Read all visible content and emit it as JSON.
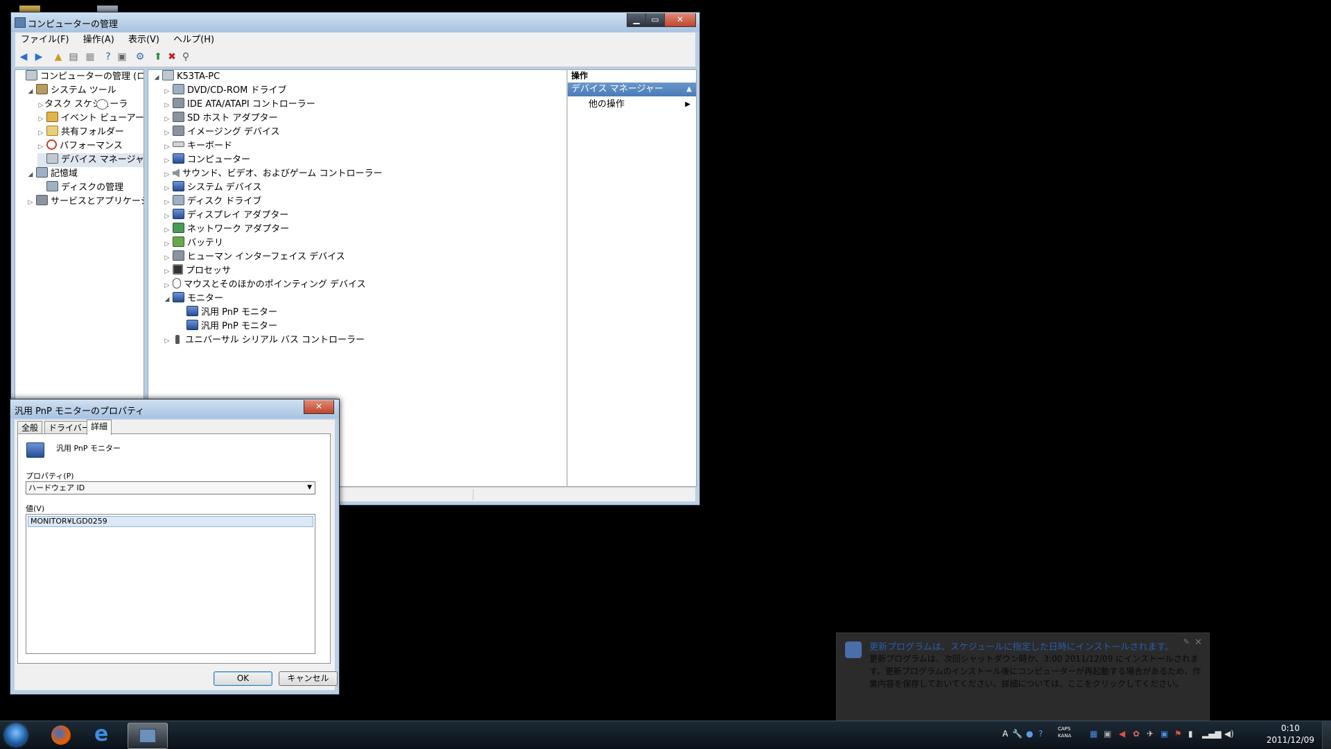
{
  "mmc": {
    "title": "コンピューターの管理",
    "menu": [
      "ファイル(F)",
      "操作(A)",
      "表示(V)",
      "ヘルプ(H)"
    ],
    "left_tree": [
      {
        "label": "コンピューターの管理 (ローカ",
        "icon": "computer-management-icon",
        "level": 0,
        "expander": ""
      },
      {
        "label": "システム ツール",
        "icon": "system-tools-icon",
        "level": 1,
        "expander": "◢"
      },
      {
        "label": "タスク スケジューラ",
        "icon": "clock-icon",
        "level": 2,
        "expander": "▷"
      },
      {
        "label": "イベント ビューアー",
        "icon": "event-viewer-icon",
        "level": 2,
        "expander": "▷"
      },
      {
        "label": "共有フォルダー",
        "icon": "shared-folder-icon",
        "level": 2,
        "expander": "▷"
      },
      {
        "label": "パフォーマンス",
        "icon": "performance-icon",
        "level": 2,
        "expander": "▷"
      },
      {
        "label": "デバイス マネージャー",
        "icon": "device-manager-icon",
        "level": 2,
        "expander": "",
        "selected": true
      },
      {
        "label": "記憶域",
        "icon": "storage-icon",
        "level": 1,
        "expander": "◢"
      },
      {
        "label": "ディスクの管理",
        "icon": "disk-management-icon",
        "level": 2,
        "expander": ""
      },
      {
        "label": "サービスとアプリケーショ",
        "icon": "services-icon",
        "level": 1,
        "expander": "▷"
      }
    ],
    "device_root": "K53TA-PC",
    "devices": [
      {
        "label": "DVD/CD-ROM ドライブ",
        "icon": "dvd-drive-icon",
        "cls": "disk",
        "expander": "▷",
        "level": 1
      },
      {
        "label": "IDE ATA/ATAPI コントローラー",
        "icon": "ide-controller-icon",
        "cls": "dev",
        "expander": "▷",
        "level": 1
      },
      {
        "label": "SD ホスト アダプター",
        "icon": "sd-host-icon",
        "cls": "dev",
        "expander": "▷",
        "level": 1
      },
      {
        "label": "イメージング デバイス",
        "icon": "imaging-device-icon",
        "cls": "dev",
        "expander": "▷",
        "level": 1
      },
      {
        "label": "キーボード",
        "icon": "keyboard-icon",
        "cls": "kb",
        "expander": "▷",
        "level": 1
      },
      {
        "label": "コンピューター",
        "icon": "computer-icon",
        "cls": "mon",
        "expander": "▷",
        "level": 1
      },
      {
        "label": "サウンド、ビデオ、およびゲーム コントローラー",
        "icon": "sound-icon",
        "cls": "snd",
        "expander": "▷",
        "level": 1
      },
      {
        "label": "システム デバイス",
        "icon": "system-device-icon",
        "cls": "mon",
        "expander": "▷",
        "level": 1
      },
      {
        "label": "ディスク ドライブ",
        "icon": "disk-drive-icon",
        "cls": "disk",
        "expander": "▷",
        "level": 1
      },
      {
        "label": "ディスプレイ アダプター",
        "icon": "display-adapter-icon",
        "cls": "mon",
        "expander": "▷",
        "level": 1
      },
      {
        "label": "ネットワーク アダプター",
        "icon": "network-adapter-icon",
        "cls": "net",
        "expander": "▷",
        "level": 1
      },
      {
        "label": "バッテリ",
        "icon": "battery-icon",
        "cls": "batt",
        "expander": "▷",
        "level": 1
      },
      {
        "label": "ヒューマン インターフェイス デバイス",
        "icon": "hid-icon",
        "cls": "dev",
        "expander": "▷",
        "level": 1
      },
      {
        "label": "プロセッサ",
        "icon": "processor-icon",
        "cls": "cpu",
        "expander": "▷",
        "level": 1
      },
      {
        "label": "マウスとそのほかのポインティング デバイス",
        "icon": "mouse-icon",
        "cls": "mouse",
        "expander": "▷",
        "level": 1
      },
      {
        "label": "モニター",
        "icon": "monitor-icon",
        "cls": "mon",
        "expander": "◢",
        "level": 1
      },
      {
        "label": "汎用 PnP モニター",
        "icon": "monitor-icon",
        "cls": "mon",
        "expander": "",
        "level": 2
      },
      {
        "label": "汎用 PnP モニター",
        "icon": "monitor-icon",
        "cls": "mon",
        "expander": "",
        "level": 2
      },
      {
        "label": "ユニバーサル シリアル バス コントローラー",
        "icon": "usb-icon",
        "cls": "usb",
        "expander": "▷",
        "level": 1
      }
    ],
    "actions": {
      "header": "操作",
      "section": "デバイス マネージャー",
      "item": "他の操作"
    }
  },
  "dialog": {
    "title": "汎用 PnP モニターのプロパティ",
    "tabs": [
      "全般",
      "ドライバー",
      "詳細"
    ],
    "device_name": "汎用 PnP モニター",
    "property_label": "プロパティ(P)",
    "property_value": "ハードウェア ID",
    "value_label": "値(V)",
    "value_item": "MONITOR¥LGD0259",
    "ok": "OK",
    "cancel": "キャンセル"
  },
  "notification": {
    "title": "更新プログラムは、スケジュールに指定した日時にインストールされます。",
    "body": "更新プログラムは、次回シャットダウン時か、3:00 2011/12/09 にインストールされます。更新プログラムのインストール後にコンピューターが再起動する場合があるため、作業内容を保存しておいてください。詳細については、ここをクリックしてください。"
  },
  "taskbar": {
    "time": "0:10",
    "date": "2011/12/09",
    "tray_text_a": "A",
    "caps": "CAPS",
    "kana": "KANA"
  }
}
